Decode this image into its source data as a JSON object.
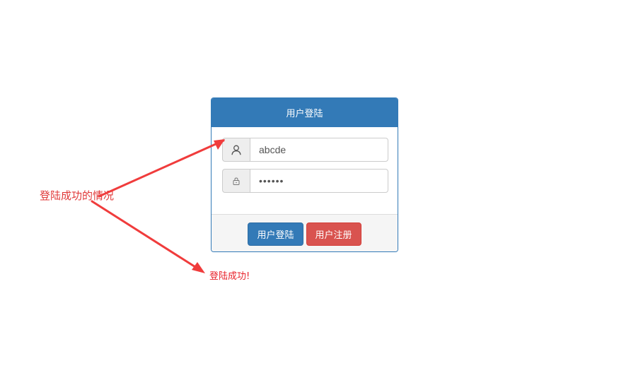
{
  "login_panel": {
    "title": "用户登陆",
    "username": {
      "icon": "user-icon",
      "value": "abcde"
    },
    "password": {
      "icon": "lock-icon",
      "masked_value": "••••••"
    },
    "buttons": {
      "login_label": "用户登陆",
      "register_label": "用户注册"
    }
  },
  "annotation": {
    "text": "登陆成功的情况"
  },
  "result": {
    "message": "登陆成功!"
  },
  "colors": {
    "primary": "#337ab7",
    "danger": "#d9534f",
    "annotation": "#e03a3a",
    "arrow": "#f03c3c"
  }
}
